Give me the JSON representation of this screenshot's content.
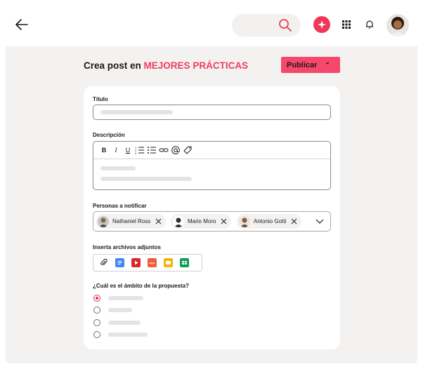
{
  "header": {
    "back_icon": "arrow-left-icon",
    "search_icon": "search-icon",
    "ai_icon": "sparkle-icon",
    "apps_icon": "grid-icon",
    "notifications_icon": "bell-icon",
    "avatar_icon": "user-avatar",
    "accent_color": "#f0375a"
  },
  "page": {
    "title_prefix": "Crea post en",
    "title_accent": "MEJORES PRÁCTICAS",
    "publish_label": "Publicar"
  },
  "form": {
    "title_label": "Título",
    "description_label": "Descripción",
    "toolbar": [
      "B",
      "I",
      "U",
      "ordered-list-icon",
      "bullet-list-icon",
      "link-icon",
      "mention-icon",
      "tag-icon"
    ],
    "notify_label": "Personas a notificar",
    "people": [
      "Nathaniel Ross",
      "Mario Moro",
      "Antonio Gotti"
    ],
    "attachments_label": "Inserta archivos adjuntos",
    "attachments": [
      "paperclip-icon",
      "google-docs-icon",
      "youtube-icon",
      "pdf-icon",
      "google-slides-icon",
      "google-sheets-icon"
    ],
    "scope_label": "¿Cuál es el ámbito de la propuesta?",
    "scope_options_count": 4,
    "scope_selected_index": 0
  }
}
